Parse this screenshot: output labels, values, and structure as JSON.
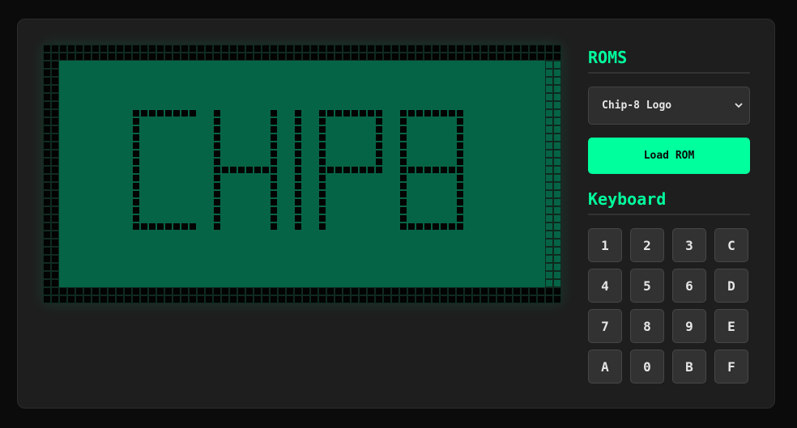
{
  "display": {
    "bitmap": [
      "................................................................",
      "................................................................",
      "..##############################################################",
      "..##############################################################",
      "..##############################################################",
      "..##############################################################",
      "..##############################################################",
      "..##############################################################",
      "..##############################################################",
      "..##############################################################",
      "..##############################################################",
      "..##############################################################",
      "..##############################################################",
      "..##############################################################",
      "..##############################################################",
      "..##############################################################",
      "..##############################################################",
      "..##############################################################",
      "..##############################################################",
      "..##############################################################",
      "..##############################################################",
      "..##############################################################",
      "..##############################################################",
      "..##############################################################",
      "..##############################################################",
      "..##############################################################",
      "..##############################################################",
      "..##############################################################",
      "..##############################################################",
      "..##############################################################",
      "................................................................",
      "................................................................"
    ],
    "letters": [
      "C",
      "H",
      "I",
      "P",
      "8"
    ],
    "on_color": "#066446",
    "off_color": "#030303"
  },
  "roms": {
    "title": "ROMS",
    "selected": "Chip-8 Logo",
    "load_label": "Load ROM"
  },
  "keyboard": {
    "title": "Keyboard",
    "keys": [
      "1",
      "2",
      "3",
      "C",
      "4",
      "5",
      "6",
      "D",
      "7",
      "8",
      "9",
      "E",
      "A",
      "0",
      "B",
      "F"
    ]
  },
  "colors": {
    "accent": "#00ff9d",
    "background": "#0b0b0b",
    "panel": "#1e1e1e"
  }
}
